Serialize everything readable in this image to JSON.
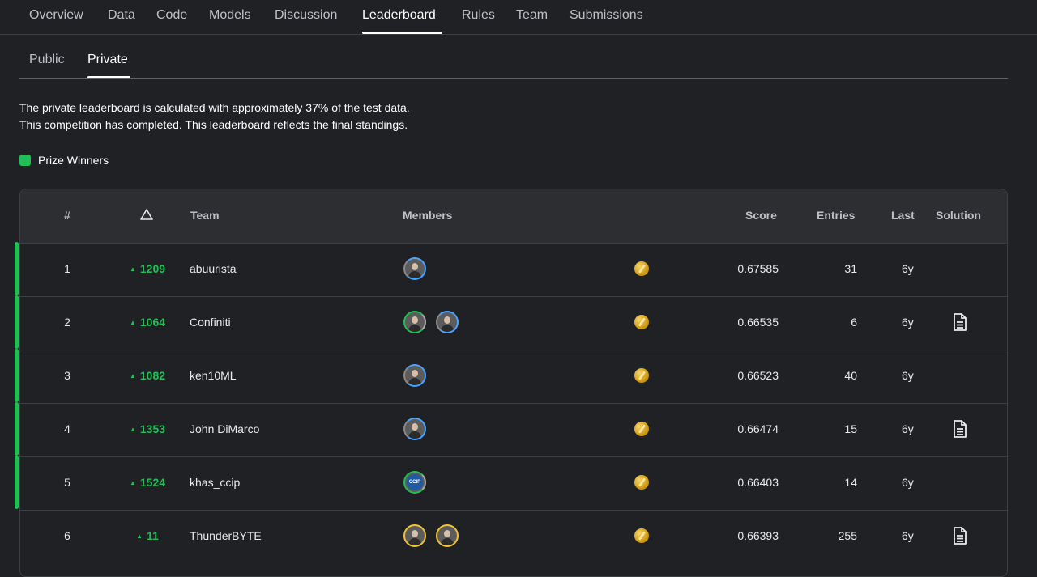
{
  "tabs": [
    "Overview",
    "Data",
    "Code",
    "Models",
    "Discussion",
    "Leaderboard",
    "Rules",
    "Team",
    "Submissions"
  ],
  "active_tab": "Leaderboard",
  "subtabs": [
    "Public",
    "Private"
  ],
  "active_subtab": "Private",
  "info": {
    "line1": "The private leaderboard is calculated with approximately 37% of the test data.",
    "line2": "This competition has completed. This leaderboard reflects the final standings."
  },
  "legend": {
    "label": "Prize Winners",
    "color": "#20BE55"
  },
  "columns": {
    "rank": "#",
    "delta_icon": "triangle-up-outline-icon",
    "team": "Team",
    "members": "Members",
    "score": "Score",
    "entries": "Entries",
    "last": "Last",
    "solution": "Solution"
  },
  "rows": [
    {
      "rank": "1",
      "delta": "1209",
      "team": "abuurista",
      "members": [
        "blue"
      ],
      "medal": "gold-medal-icon",
      "score": "0.67585",
      "entries": "31",
      "last": "6y",
      "solution": false,
      "prize": true
    },
    {
      "rank": "2",
      "delta": "1064",
      "team": "Confiniti",
      "members": [
        "green",
        "blue"
      ],
      "medal": "gold-medal-icon",
      "score": "0.66535",
      "entries": "6",
      "last": "6y",
      "solution": true,
      "prize": true
    },
    {
      "rank": "3",
      "delta": "1082",
      "team": "ken10ML",
      "members": [
        "blue"
      ],
      "medal": "gold-medal-icon",
      "score": "0.66523",
      "entries": "40",
      "last": "6y",
      "solution": false,
      "prize": true
    },
    {
      "rank": "4",
      "delta": "1353",
      "team": "John DiMarco",
      "members": [
        "blue"
      ],
      "medal": "gold-medal-icon",
      "score": "0.66474",
      "entries": "15",
      "last": "6y",
      "solution": true,
      "prize": true
    },
    {
      "rank": "5",
      "delta": "1524",
      "team": "khas_ccip",
      "members": [
        "green-ccip"
      ],
      "medal": "gold-medal-icon",
      "score": "0.66403",
      "entries": "14",
      "last": "6y",
      "solution": false,
      "prize": true
    },
    {
      "rank": "6",
      "delta": "11",
      "team": "ThunderBYTE",
      "members": [
        "gold",
        "gold"
      ],
      "medal": "gold-medal-icon",
      "score": "0.66393",
      "entries": "255",
      "last": "6y",
      "solution": true,
      "prize": false
    }
  ]
}
